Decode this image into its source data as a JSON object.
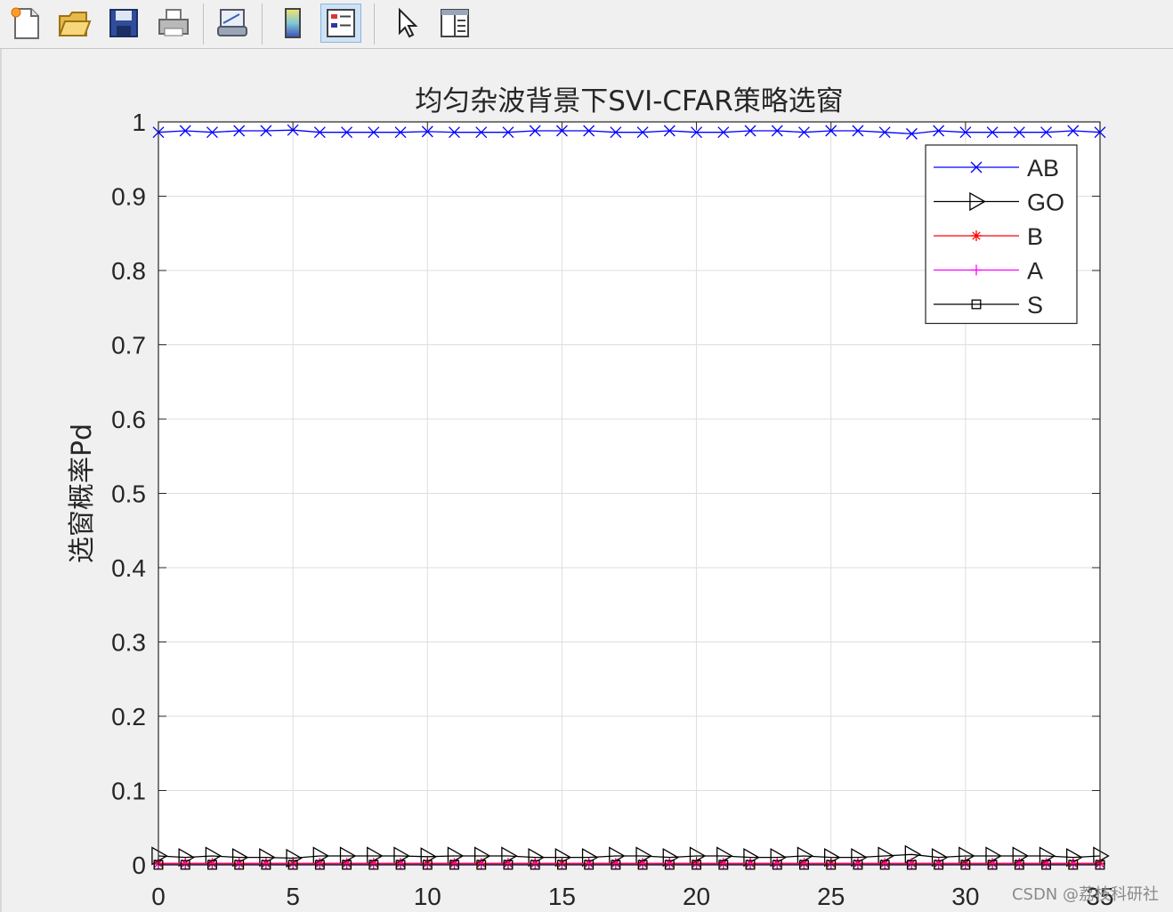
{
  "toolbar": {
    "buttons": [
      {
        "name": "new-figure-icon"
      },
      {
        "name": "open-file-icon"
      },
      {
        "name": "save-icon"
      },
      {
        "name": "print-icon"
      },
      {
        "name": "link-plot-icon"
      },
      {
        "name": "colorbar-icon"
      },
      {
        "name": "legend-icon",
        "active": true
      },
      {
        "name": "select-pointer-icon"
      },
      {
        "name": "property-editor-icon"
      }
    ]
  },
  "chart_data": {
    "type": "line",
    "title": "均匀杂波背景下SVI-CFAR策略选窗",
    "xlabel": "",
    "ylabel": "选窗概率Pd",
    "xlim": [
      0,
      35
    ],
    "ylim": [
      0,
      1
    ],
    "xticks": [
      "0",
      "5",
      "10",
      "15",
      "20",
      "25",
      "30",
      "35"
    ],
    "yticks": [
      "0",
      "0.1",
      "0.2",
      "0.3",
      "0.4",
      "0.5",
      "0.6",
      "0.7",
      "0.8",
      "0.9",
      "1"
    ],
    "grid": true,
    "legend_position": "top-right",
    "x": [
      0,
      1,
      2,
      3,
      4,
      5,
      6,
      7,
      8,
      9,
      10,
      11,
      12,
      13,
      14,
      15,
      16,
      17,
      18,
      19,
      20,
      21,
      22,
      23,
      24,
      25,
      26,
      27,
      28,
      29,
      30,
      31,
      32,
      33,
      34,
      35
    ],
    "series": [
      {
        "name": "AB",
        "color": "#0000ff",
        "marker": "x",
        "values": [
          0.986,
          0.988,
          0.986,
          0.988,
          0.988,
          0.989,
          0.986,
          0.986,
          0.986,
          0.986,
          0.987,
          0.986,
          0.986,
          0.986,
          0.988,
          0.988,
          0.988,
          0.986,
          0.986,
          0.988,
          0.986,
          0.986,
          0.988,
          0.988,
          0.986,
          0.988,
          0.988,
          0.986,
          0.984,
          0.988,
          0.986,
          0.986,
          0.986,
          0.986,
          0.988,
          0.986
        ]
      },
      {
        "name": "GO",
        "color": "#000000",
        "marker": "triangle-right",
        "values": [
          0.012,
          0.01,
          0.012,
          0.01,
          0.01,
          0.009,
          0.012,
          0.012,
          0.012,
          0.012,
          0.011,
          0.012,
          0.012,
          0.012,
          0.01,
          0.01,
          0.01,
          0.012,
          0.012,
          0.01,
          0.012,
          0.012,
          0.01,
          0.01,
          0.012,
          0.01,
          0.01,
          0.012,
          0.014,
          0.01,
          0.012,
          0.012,
          0.012,
          0.012,
          0.01,
          0.012
        ]
      },
      {
        "name": "B",
        "color": "#ff0000",
        "marker": "asterisk",
        "values": [
          0.002,
          0.002,
          0.002,
          0.002,
          0.002,
          0.002,
          0.002,
          0.002,
          0.002,
          0.002,
          0.002,
          0.002,
          0.002,
          0.002,
          0.002,
          0.002,
          0.002,
          0.002,
          0.002,
          0.002,
          0.002,
          0.002,
          0.002,
          0.002,
          0.002,
          0.002,
          0.002,
          0.002,
          0.002,
          0.002,
          0.002,
          0.002,
          0.002,
          0.002,
          0.002,
          0.002
        ]
      },
      {
        "name": "A",
        "color": "#ff00ff",
        "marker": "plus",
        "values": [
          0.001,
          0.001,
          0.001,
          0.001,
          0.001,
          0.001,
          0.001,
          0.001,
          0.001,
          0.001,
          0.001,
          0.001,
          0.001,
          0.001,
          0.001,
          0.001,
          0.001,
          0.001,
          0.001,
          0.001,
          0.001,
          0.001,
          0.001,
          0.001,
          0.001,
          0.001,
          0.001,
          0.001,
          0.001,
          0.001,
          0.001,
          0.001,
          0.001,
          0.001,
          0.001,
          0.001
        ]
      },
      {
        "name": "S",
        "color": "#000000",
        "marker": "square",
        "values": [
          0,
          0,
          0,
          0,
          0,
          0,
          0,
          0,
          0,
          0,
          0,
          0,
          0,
          0,
          0,
          0,
          0,
          0,
          0,
          0,
          0,
          0,
          0,
          0,
          0,
          0,
          0,
          0,
          0,
          0,
          0,
          0,
          0,
          0,
          0,
          0
        ]
      }
    ]
  },
  "watermark": "CSDN @荔枝科研社"
}
